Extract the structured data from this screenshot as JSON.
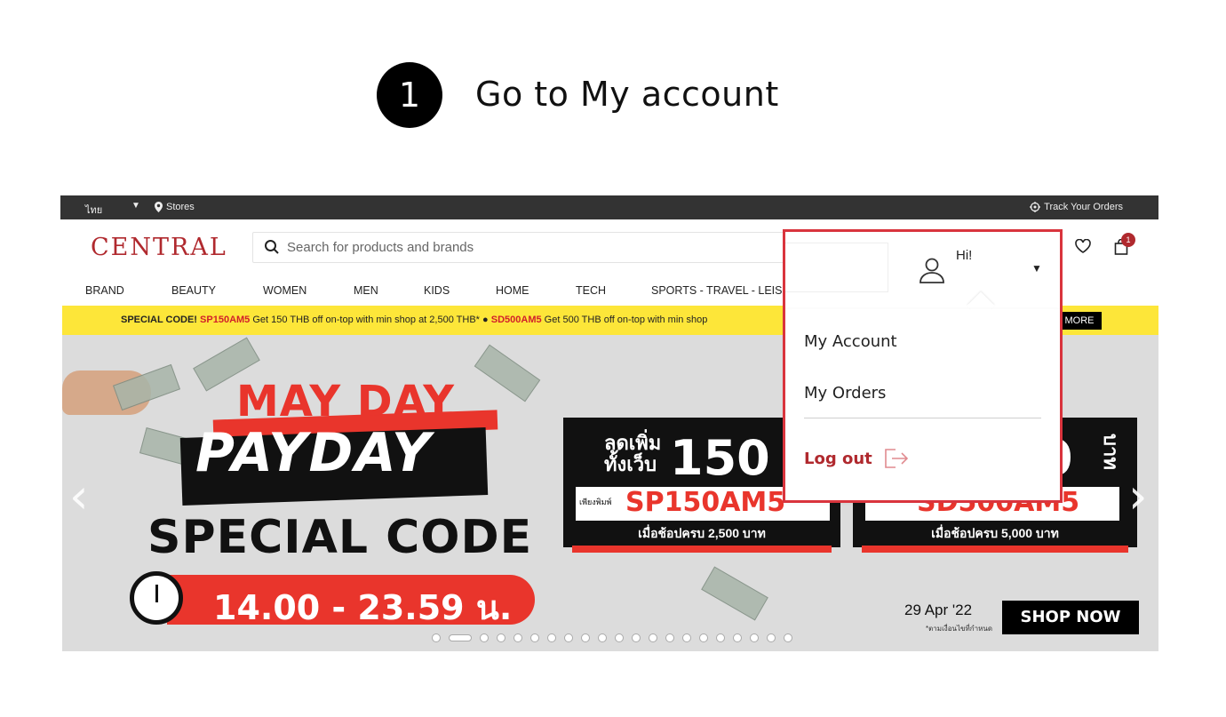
{
  "step": {
    "number": "1",
    "title": "Go to My account"
  },
  "topbar": {
    "language": "ไทย",
    "stores": "Stores",
    "track_orders": "Track Your Orders"
  },
  "header": {
    "logo": "CENTRAL",
    "search_placeholder": "Search for products and brands",
    "cart_count": "1",
    "greeting": "Hi!"
  },
  "nav": {
    "items": [
      "BRAND",
      "BEAUTY",
      "WOMEN",
      "MEN",
      "KIDS",
      "HOME",
      "TECH",
      "SPORTS - TRAVEL - LEIS"
    ]
  },
  "promo": {
    "lead": "SPECIAL CODE!",
    "code1": "SP150AM5",
    "text1": "Get 150 THB off on-top with min shop at 2,500 THB*",
    "bullet": "●",
    "code2": "SD500AM5",
    "text2": "Get 500 THB off on-top with min shop",
    "more": "MORE"
  },
  "banner": {
    "line1": "MAY DAY",
    "line2": "PAYDAY",
    "line3": "SPECIAL CODE",
    "time": "14.00 - 23.59 น.",
    "ticket1": {
      "line_a": "ลดเพิ่ม",
      "line_b": "ทั้งเว็บ",
      "amount": "150",
      "small": "เพียงพิมพ์",
      "code": "SP150AM5",
      "condition": "เมื่อช้อปครบ 2,500 บาท"
    },
    "ticket2": {
      "amount": "0",
      "unit": "บาท",
      "code": "SD500AM5",
      "condition": "เมื่อช้อปครบ 5,000 บาท"
    },
    "date": "29 Apr '22",
    "date_note": "*ตามเงื่อนไขที่กำหนด",
    "shop_now": "SHOP NOW",
    "slide_count": 21,
    "active_slide": 2
  },
  "account_menu": {
    "items": [
      "My Account",
      "My Orders"
    ],
    "logout": "Log out"
  },
  "colors": {
    "brand_red": "#b0292e",
    "promo_yellow": "#fde639",
    "highlight": "#d9343d",
    "banner_red": "#e9352c"
  }
}
